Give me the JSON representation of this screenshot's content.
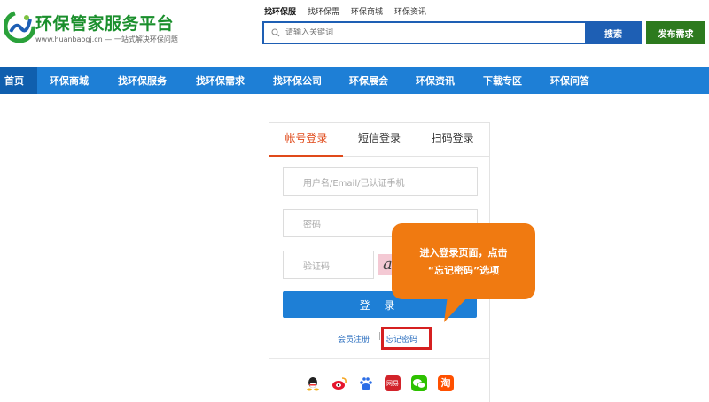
{
  "header": {
    "site_title": "环保管家服务平台",
    "site_url": "www.huanbaogj.cn",
    "slogan": "一站式解决环保问题",
    "top_links": [
      "找环保服",
      "找环保需",
      "环保商城",
      "环保资讯"
    ],
    "search_placeholder": "请输入关键词",
    "search_button": "搜索",
    "publish_button": "发布需求"
  },
  "nav": {
    "items": [
      "首页",
      "环保商城",
      "找环保服务",
      "找环保需求",
      "找环保公司",
      "环保展会",
      "环保资讯",
      "下载专区",
      "环保问答"
    ]
  },
  "login": {
    "tabs": [
      "帐号登录",
      "短信登录",
      "扫码登录"
    ],
    "username_placeholder": "用户名/Email/已认证手机",
    "password_placeholder": "密码",
    "captcha_placeholder": "验证码",
    "captcha_text": "a",
    "login_button": "登 录",
    "register_link": "会员注册",
    "separator": "|",
    "forgot_link": "忘记密码"
  },
  "social": {
    "icons": [
      "qq-icon",
      "weibo-icon",
      "baidu-icon",
      "netease-icon",
      "wechat-icon",
      "taobao-icon"
    ],
    "netease_text": "网易",
    "taobao_text": "淘"
  },
  "callout": {
    "line1": "进入登录页面，点击",
    "line2": "“忘记密码”选项"
  },
  "colors": {
    "brand_green": "#1a8f2c",
    "nav_blue": "#1e7fd6",
    "active_tab": "#e04a1a",
    "callout_orange": "#f07a11",
    "highlight_red": "#d62020"
  }
}
